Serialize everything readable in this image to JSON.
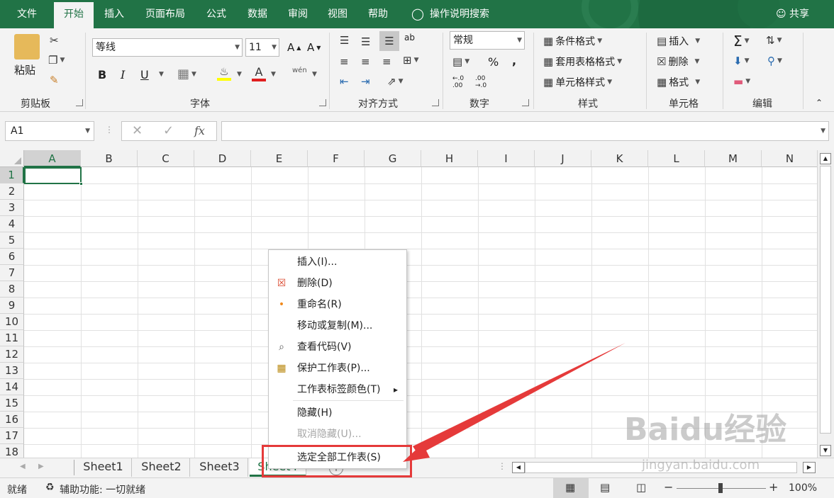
{
  "ribbon_tabs": [
    "文件",
    "开始",
    "插入",
    "页面布局",
    "公式",
    "数据",
    "审阅",
    "视图",
    "帮助"
  ],
  "active_tab": "开始",
  "tell_me": "操作说明搜索",
  "share": "共享",
  "clipboard": {
    "paste": "粘贴",
    "label": "剪贴板"
  },
  "font": {
    "name": "等线",
    "size": "11",
    "label": "字体",
    "bold": "B",
    "italic": "I",
    "underline": "U",
    "grow": "A",
    "shrink": "A",
    "phonetic": "wén"
  },
  "alignment": {
    "label": "对齐方式",
    "wrap": "ab"
  },
  "number": {
    "format": "常规",
    "label": "数字",
    "percent": "%",
    "comma": ","
  },
  "styles": {
    "conditional": "条件格式",
    "table": "套用表格格式",
    "cell": "单元格样式",
    "label": "样式"
  },
  "cells": {
    "insert": "插入",
    "delete": "删除",
    "format": "格式",
    "label": "单元格"
  },
  "editing": {
    "label": "编辑"
  },
  "namebox": "A1",
  "formula_fx": "fx",
  "columns": [
    "A",
    "B",
    "C",
    "D",
    "E",
    "F",
    "G",
    "H",
    "I",
    "J",
    "K",
    "L",
    "M",
    "N"
  ],
  "rows": [
    "1",
    "2",
    "3",
    "4",
    "5",
    "6",
    "7",
    "8",
    "9",
    "10",
    "11",
    "12",
    "13",
    "14",
    "15",
    "16",
    "17",
    "18"
  ],
  "sheets": [
    "Sheet1",
    "Sheet2",
    "Sheet3",
    "Sheet4"
  ],
  "active_sheet": "Sheet4",
  "context_menu": [
    {
      "label": "插入(I)...",
      "icon": "",
      "enabled": true
    },
    {
      "label": "删除(D)",
      "icon": "delete-sheet-icon",
      "enabled": true
    },
    {
      "label": "重命名(R)",
      "icon": "dot-icon",
      "enabled": true
    },
    {
      "label": "移动或复制(M)...",
      "icon": "",
      "enabled": true
    },
    {
      "label": "查看代码(V)",
      "icon": "view-code-icon",
      "enabled": true
    },
    {
      "label": "保护工作表(P)...",
      "icon": "protect-sheet-icon",
      "enabled": true
    },
    {
      "label": "工作表标签颜色(T)",
      "icon": "",
      "enabled": true,
      "submenu": true
    },
    {
      "label": "隐藏(H)",
      "icon": "",
      "enabled": true
    },
    {
      "label": "取消隐藏(U)...",
      "icon": "",
      "enabled": false
    },
    {
      "label": "选定全部工作表(S)",
      "icon": "",
      "enabled": true
    }
  ],
  "status": {
    "ready": "就绪",
    "accessibility": "辅助功能: 一切就绪",
    "zoom": "100%"
  },
  "watermark": {
    "main": "Baidu经验",
    "sub": "jingyan.baidu.com"
  },
  "colors": {
    "excel_green": "#217346",
    "highlight_red": "#e53a3a"
  }
}
